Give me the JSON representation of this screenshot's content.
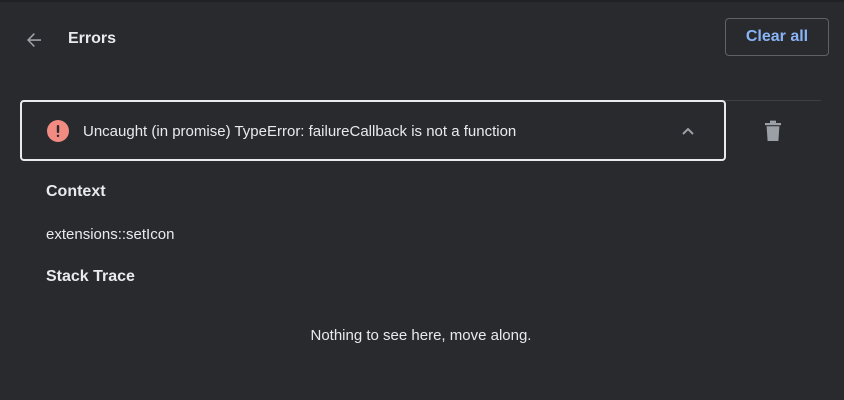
{
  "header": {
    "title": "Errors",
    "clear_all_label": "Clear all"
  },
  "error": {
    "message": "Uncaught (in promise) TypeError: failureCallback is not a function",
    "expanded": true
  },
  "details": {
    "context_heading": "Context",
    "context_value": "extensions::setIcon",
    "stack_heading": "Stack Trace",
    "stack_empty_message": "Nothing to see here, move along."
  },
  "icons": {
    "back": "arrow-left-icon",
    "error": "error-circle-icon",
    "collapse": "chevron-up-icon",
    "delete": "trash-icon"
  },
  "colors": {
    "background": "#292a2d",
    "accent": "#8ab4f8",
    "error": "#f28b82",
    "text": "#e8eaed"
  }
}
